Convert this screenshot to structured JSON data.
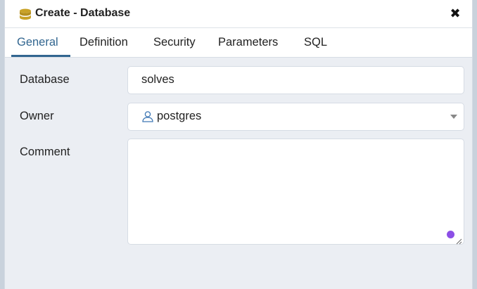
{
  "dialog": {
    "title": "Create - Database",
    "title_icon": "database-icon",
    "close_icon": "close-icon",
    "close_glyph": "✖"
  },
  "tabs": [
    {
      "label": "General",
      "active": true
    },
    {
      "label": "Definition",
      "active": false
    },
    {
      "label": "Security",
      "active": false
    },
    {
      "label": "Parameters",
      "active": false
    },
    {
      "label": "SQL",
      "active": false
    }
  ],
  "form": {
    "database": {
      "label": "Database",
      "value": "solves"
    },
    "owner": {
      "label": "Owner",
      "value": "postgres",
      "icon": "user-icon"
    },
    "comment": {
      "label": "Comment",
      "value": ""
    }
  },
  "colors": {
    "accent": "#326690",
    "panel_bg": "#ebeef3",
    "db_icon": "#c9a227",
    "dot": "#8c4fe6"
  }
}
